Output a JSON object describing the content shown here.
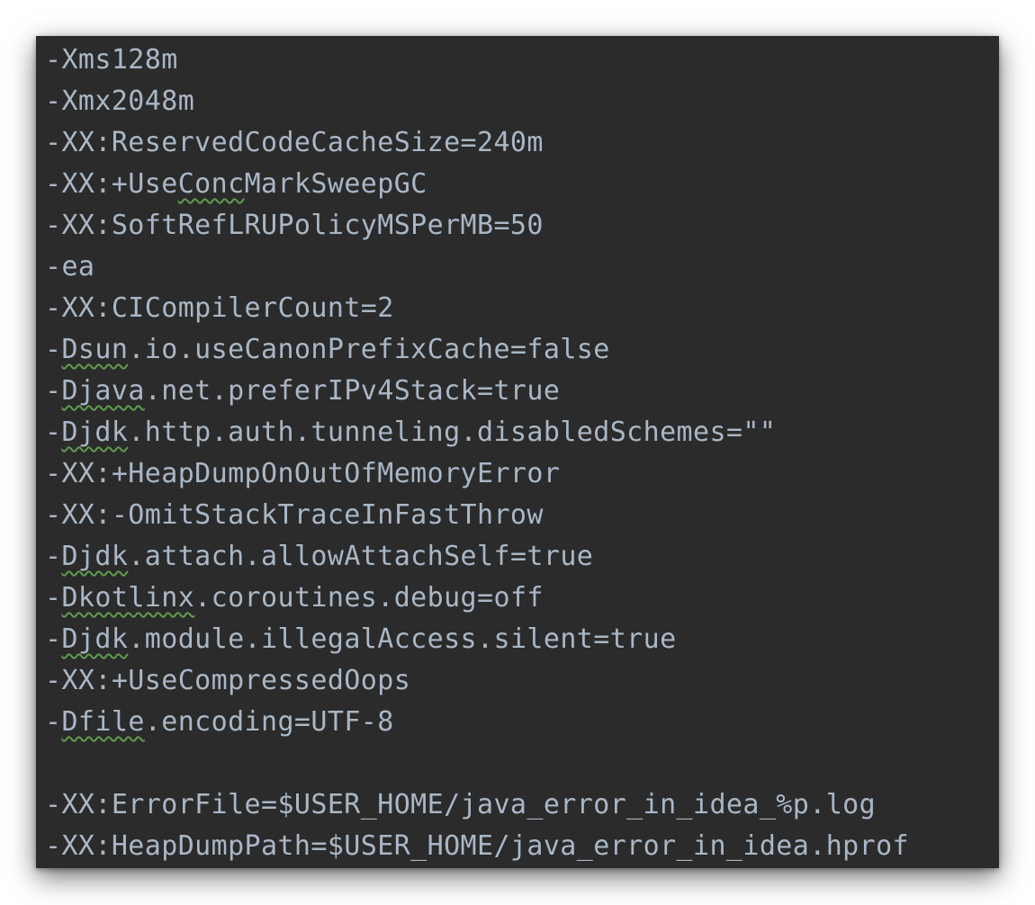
{
  "editor": {
    "lines": [
      [
        {
          "t": "-Xms128m"
        }
      ],
      [
        {
          "t": "-Xmx2048m"
        }
      ],
      [
        {
          "t": "-XX:ReservedCodeCacheSize=240m"
        }
      ],
      [
        {
          "t": "-XX:+Use"
        },
        {
          "t": "Conc",
          "typo": true
        },
        {
          "t": "MarkSweepGC"
        }
      ],
      [
        {
          "t": "-XX:SoftRefLRUPolicyMSPerMB=50"
        }
      ],
      [
        {
          "t": "-ea"
        }
      ],
      [
        {
          "t": "-XX:CICompilerCount=2"
        }
      ],
      [
        {
          "t": "-"
        },
        {
          "t": "Dsun",
          "typo": true
        },
        {
          "t": ".io.useCanonPrefixCache=false"
        }
      ],
      [
        {
          "t": "-"
        },
        {
          "t": "Djava",
          "typo": true
        },
        {
          "t": ".net.preferIPv4Stack=true"
        }
      ],
      [
        {
          "t": "-"
        },
        {
          "t": "Djdk",
          "typo": true
        },
        {
          "t": ".http.auth.tunneling.disabledSchemes=\"\""
        }
      ],
      [
        {
          "t": "-XX:+HeapDumpOnOutOfMemoryError"
        }
      ],
      [
        {
          "t": "-XX:-OmitStackTraceInFastThrow"
        }
      ],
      [
        {
          "t": "-"
        },
        {
          "t": "Djdk",
          "typo": true
        },
        {
          "t": ".attach.allowAttachSelf=true"
        }
      ],
      [
        {
          "t": "-"
        },
        {
          "t": "Dkotlinx",
          "typo": true
        },
        {
          "t": ".coroutines.debug=off"
        }
      ],
      [
        {
          "t": "-"
        },
        {
          "t": "Djdk",
          "typo": true
        },
        {
          "t": ".module.illegalAccess.silent=true"
        }
      ],
      [
        {
          "t": "-XX:+UseCompressedOops"
        }
      ],
      [
        {
          "t": "-"
        },
        {
          "t": "Dfile",
          "typo": true
        },
        {
          "t": ".encoding=UTF-8"
        }
      ],
      [
        {
          "t": ""
        }
      ],
      [
        {
          "t": "-XX:ErrorFile=$USER_HOME/java_error_in_idea_%p.log"
        }
      ],
      [
        {
          "t": "-XX:HeapDumpPath=$USER_HOME/java_error_in_idea.hprof"
        }
      ]
    ]
  },
  "colors": {
    "background": "#2b2b2b",
    "text": "#a9b7c6",
    "typo_underline": "#5f9c4f"
  }
}
